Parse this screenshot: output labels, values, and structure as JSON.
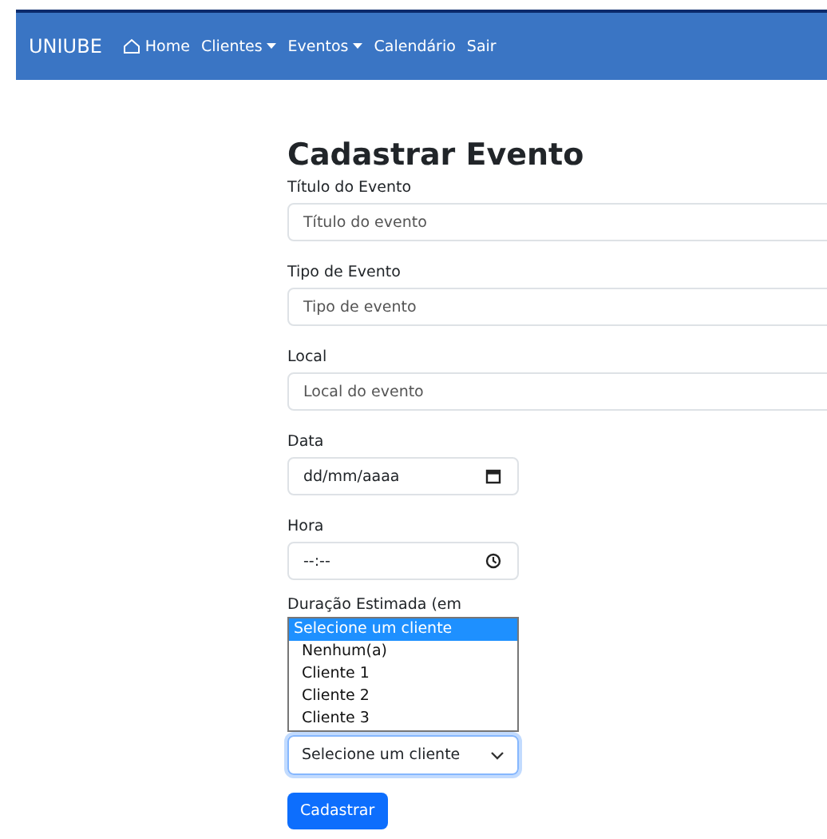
{
  "navbar": {
    "brand": "UNIUBE",
    "items": [
      {
        "label": "Home",
        "kind": "home"
      },
      {
        "label": "Clientes",
        "kind": "dropdown"
      },
      {
        "label": "Eventos",
        "kind": "dropdown"
      },
      {
        "label": "Calendário",
        "kind": "link"
      },
      {
        "label": "Sair",
        "kind": "link"
      }
    ]
  },
  "form": {
    "title": "Cadastrar Evento",
    "fields": [
      {
        "label": "Título do Evento",
        "placeholder": "Título do evento",
        "kind": "text"
      },
      {
        "label": "Tipo de Evento",
        "placeholder": "Tipo de evento",
        "kind": "text"
      },
      {
        "label": "Local",
        "placeholder": "Local do evento",
        "kind": "text"
      },
      {
        "label": "Data",
        "placeholder": "dd/mm/aaaa",
        "kind": "date"
      },
      {
        "label": "Hora",
        "placeholder": "--:--",
        "kind": "time"
      }
    ],
    "covered_label": "Duração Estimada (em",
    "select": {
      "value": "Selecione um cliente",
      "focused": true,
      "options": [
        {
          "label": "Selecione um cliente",
          "selected": true
        },
        {
          "label": "Nenhum(a)",
          "selected": false
        },
        {
          "label": "Cliente 1",
          "selected": false
        },
        {
          "label": "Cliente 2",
          "selected": false
        },
        {
          "label": "Cliente 3",
          "selected": false
        }
      ]
    },
    "submit": "Cadastrar"
  }
}
